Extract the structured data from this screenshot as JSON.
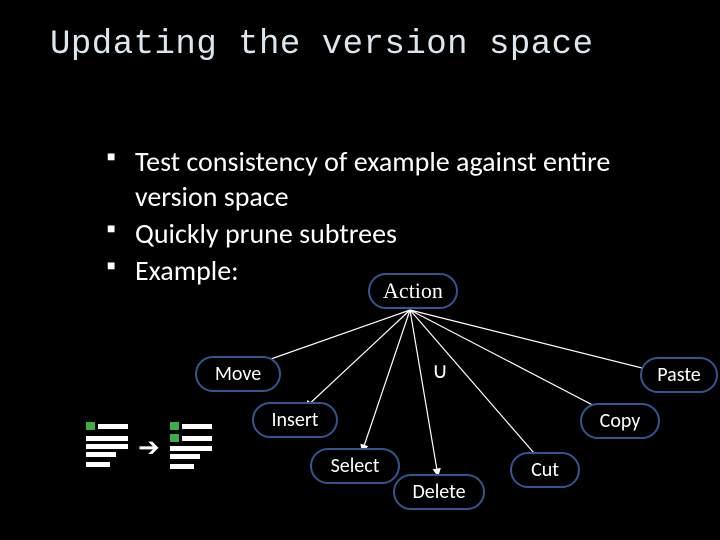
{
  "title": "Updating the version space",
  "bullets": [
    "Test consistency of example against entire version space",
    "Quickly prune subtrees",
    "Example:"
  ],
  "nodes": {
    "action": "Action",
    "move": "Move",
    "insert": "Insert",
    "select": "Select",
    "delete": "Delete",
    "cut": "Cut",
    "copy": "Copy",
    "paste": "Paste"
  },
  "cup_symbol": "∪"
}
